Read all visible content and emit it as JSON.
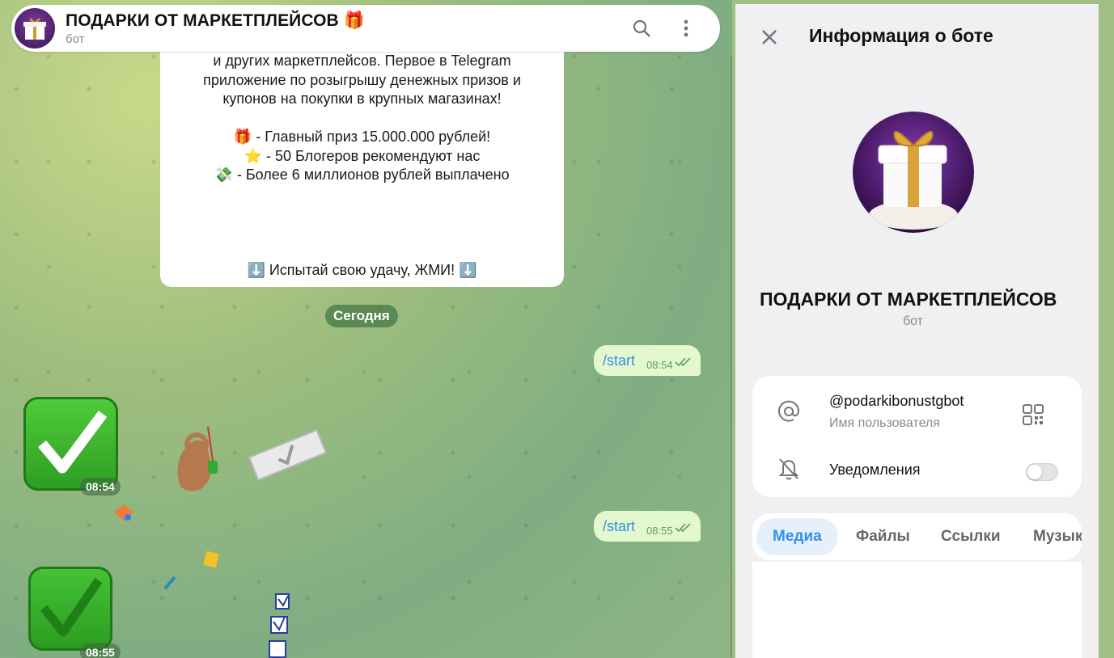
{
  "header": {
    "title": "ПОДАРКИ ОТ МАРКЕТПЛЕЙСОВ 🎁",
    "subtitle": "бот"
  },
  "welcome": {
    "lines": [
      "и других маркетплейсов. Первое в Telegram",
      "приложение по розыгрышу денежных призов и",
      "купонов на покупки в крупных магазинах!"
    ],
    "bullets": [
      "🎁 - Главный приз 15.000.000 рублей!",
      "⭐ - 50 Блогеров рекомендуют нас",
      "💸 - Более 6 миллионов рублей выплачено"
    ],
    "cta": "⬇️ Испытай свою удачу, ЖМИ! ⬇️"
  },
  "date_pill": "Сегодня",
  "messages": [
    {
      "text": "/start",
      "time": "08:54"
    },
    {
      "text": "/start",
      "time": "08:55"
    }
  ],
  "emoji_times": [
    "08:54",
    "08:55"
  ],
  "panel": {
    "title": "Информация о боте",
    "bot_name": "ПОДАРКИ ОТ МАРКЕТПЛЕЙСОВ",
    "bot_sub": "бот",
    "username": "@podarkibonustgbot",
    "username_label": "Имя пользователя",
    "notifications_label": "Уведомления",
    "notifications_on": false,
    "tabs": [
      "Медиа",
      "Файлы",
      "Ссылки",
      "Музык"
    ],
    "active_tab": "Медиа"
  },
  "colors": {
    "accent": "#3390ec",
    "out_bubble": "#e3f8cd",
    "check_green": "#2f9e23"
  }
}
